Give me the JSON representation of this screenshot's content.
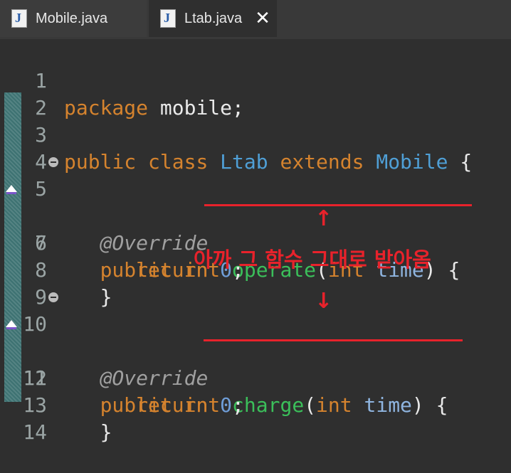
{
  "tabs": [
    {
      "label": "Mobile.java",
      "icon": "java-file-icon",
      "active": false
    },
    {
      "label": "Ltab.java",
      "icon": "java-file-icon",
      "active": true,
      "close_icon": "close-icon"
    }
  ],
  "code_lines": [
    {
      "number": "1",
      "text": "package mobile;"
    },
    {
      "number": "2",
      "text": ""
    },
    {
      "number": "3",
      "text": "public class Ltab extends Mobile {"
    },
    {
      "number": "4",
      "text": ""
    },
    {
      "number": "5",
      "text": "    @Override",
      "fold_icon": "fold-collapse-icon"
    },
    {
      "number": "6",
      "text": "    public int operate(int time) {",
      "gutter_icon": "override-marker-icon"
    },
    {
      "number": "7",
      "text": "        return 0;"
    },
    {
      "number": "8",
      "text": "    }"
    },
    {
      "number": "9",
      "text": ""
    },
    {
      "number": "10",
      "text": "    @Override",
      "fold_icon": "fold-collapse-icon"
    },
    {
      "number": "11",
      "text": "    public int charge(int time) {",
      "gutter_icon": "override-marker-icon"
    },
    {
      "number": "12",
      "text": "        return 0;"
    },
    {
      "number": "13",
      "text": "    }"
    },
    {
      "number": "14",
      "text": ""
    }
  ],
  "tokens": {
    "package": "package",
    "mobile_pkg": "mobile;",
    "public": "public",
    "class": "class",
    "ltab": "Ltab",
    "extends": "extends",
    "mobile_cls": "Mobile",
    "brace_open": "{",
    "brace_close": "}",
    "override": "@Override",
    "int": "int",
    "operate": "operate",
    "charge": "charge",
    "paren_open": "(",
    "time": "time",
    "paren_close_brace": ") {",
    "return": "return",
    "zero": "0",
    "semi": ";"
  },
  "annotation": {
    "text": "아까 그 함수 그대로 받아옴",
    "arrow_up": "↑",
    "arrow_down": "↓",
    "color": "#e8222b"
  },
  "colors": {
    "keyword": "#d5832e",
    "class_name": "#4f9fd6",
    "method": "#3bbf5a",
    "background": "#2f2f2f"
  }
}
